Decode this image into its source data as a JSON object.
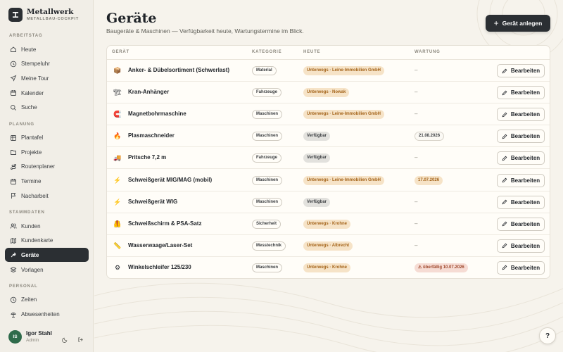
{
  "brand": {
    "name": "Metallwerk",
    "subtitle": "METALLBAU-COCKPIT"
  },
  "sidebar": {
    "sections": [
      {
        "title": "ARBEITSTAG",
        "items": [
          {
            "label": "Heute",
            "icon": "home-icon"
          },
          {
            "label": "Stempeluhr",
            "icon": "clock-icon"
          },
          {
            "label": "Meine Tour",
            "icon": "navigation-icon"
          },
          {
            "label": "Kalender",
            "icon": "calendar-icon"
          },
          {
            "label": "Suche",
            "icon": "search-icon"
          }
        ]
      },
      {
        "title": "PLANUNG",
        "items": [
          {
            "label": "Plantafel",
            "icon": "board-icon"
          },
          {
            "label": "Projekte",
            "icon": "folder-icon"
          },
          {
            "label": "Routenplaner",
            "icon": "route-icon"
          },
          {
            "label": "Termine",
            "icon": "calendar-icon"
          },
          {
            "label": "Nacharbeit",
            "icon": "flag-icon"
          }
        ]
      },
      {
        "title": "STAMMDATEN",
        "items": [
          {
            "label": "Kunden",
            "icon": "users-icon"
          },
          {
            "label": "Kundenkarte",
            "icon": "map-icon"
          },
          {
            "label": "Geräte",
            "icon": "wrench-icon",
            "active": true
          },
          {
            "label": "Vorlagen",
            "icon": "layers-icon"
          }
        ]
      },
      {
        "title": "PERSONAL",
        "items": [
          {
            "label": "Zeiten",
            "icon": "clock-icon"
          },
          {
            "label": "Abwesenheiten",
            "icon": "vacation-icon"
          }
        ]
      }
    ]
  },
  "user": {
    "initials": "IS",
    "name": "Igor Stahl",
    "role": "Admin"
  },
  "page": {
    "title": "Geräte",
    "subtitle": "Baugeräte & Maschinen — Verfügbarkeit heute, Wartungstermine im Blick.",
    "add_button": "Gerät anlegen"
  },
  "table": {
    "columns": [
      "GERÄT",
      "KATEGORIE",
      "HEUTE",
      "WARTUNG"
    ],
    "edit_label": "Bearbeiten",
    "rows": [
      {
        "emoji": "📦",
        "name": "Anker- & Dübelsortiment (Schwerlast)",
        "category": "Material",
        "status": "Unterwegs · Leine-Immobilien GmbH",
        "status_type": "busy",
        "maintenance": "–",
        "maint_type": "none"
      },
      {
        "emoji": "🏗",
        "name": "Kran-Anhänger",
        "category": "Fahrzeuge",
        "status": "Unterwegs · Nowak",
        "status_type": "busy",
        "maintenance": "–",
        "maint_type": "none"
      },
      {
        "emoji": "🧲",
        "name": "Magnetbohrmaschine",
        "category": "Maschinen",
        "status": "Unterwegs · Leine-Immobilien GmbH",
        "status_type": "busy",
        "maintenance": "–",
        "maint_type": "none"
      },
      {
        "emoji": "🔥",
        "name": "Plasmaschneider",
        "category": "Maschinen",
        "status": "Verfügbar",
        "status_type": "free",
        "maintenance": "21.08.2026",
        "maint_type": "date"
      },
      {
        "emoji": "🚚",
        "name": "Pritsche 7,2 m",
        "category": "Fahrzeuge",
        "status": "Verfügbar",
        "status_type": "free",
        "maintenance": "–",
        "maint_type": "none"
      },
      {
        "emoji": "⚡",
        "name": "Schweißgerät MIG/MAG (mobil)",
        "category": "Maschinen",
        "status": "Unterwegs · Leine-Immobilien GmbH",
        "status_type": "busy",
        "maintenance": "17.07.2026",
        "maint_type": "soon"
      },
      {
        "emoji": "⚡",
        "name": "Schweißgerät WIG",
        "category": "Maschinen",
        "status": "Verfügbar",
        "status_type": "free",
        "maintenance": "–",
        "maint_type": "none"
      },
      {
        "emoji": "🦺",
        "name": "Schweißschirm & PSA-Satz",
        "category": "Sicherheit",
        "status": "Unterwegs · Krohne",
        "status_type": "busy",
        "maintenance": "–",
        "maint_type": "none"
      },
      {
        "emoji": "📏",
        "name": "Wasserwaage/Laser-Set",
        "category": "Messtechnik",
        "status": "Unterwegs · Albrecht",
        "status_type": "busy",
        "maintenance": "–",
        "maint_type": "none"
      },
      {
        "emoji": "⚙",
        "name": "Winkelschleifer 125/230",
        "category": "Maschinen",
        "status": "Unterwegs · Krohne",
        "status_type": "busy",
        "maintenance": "⚠ überfällig 10.07.2026",
        "maint_type": "over"
      }
    ]
  },
  "help": {
    "label": "?"
  },
  "colors": {
    "accent": "#2b2f33",
    "busy_bg": "#f6e3c7",
    "busy_text": "#a4641a",
    "overdue_bg": "#f6dcd4",
    "success": "#2f6b4b"
  }
}
